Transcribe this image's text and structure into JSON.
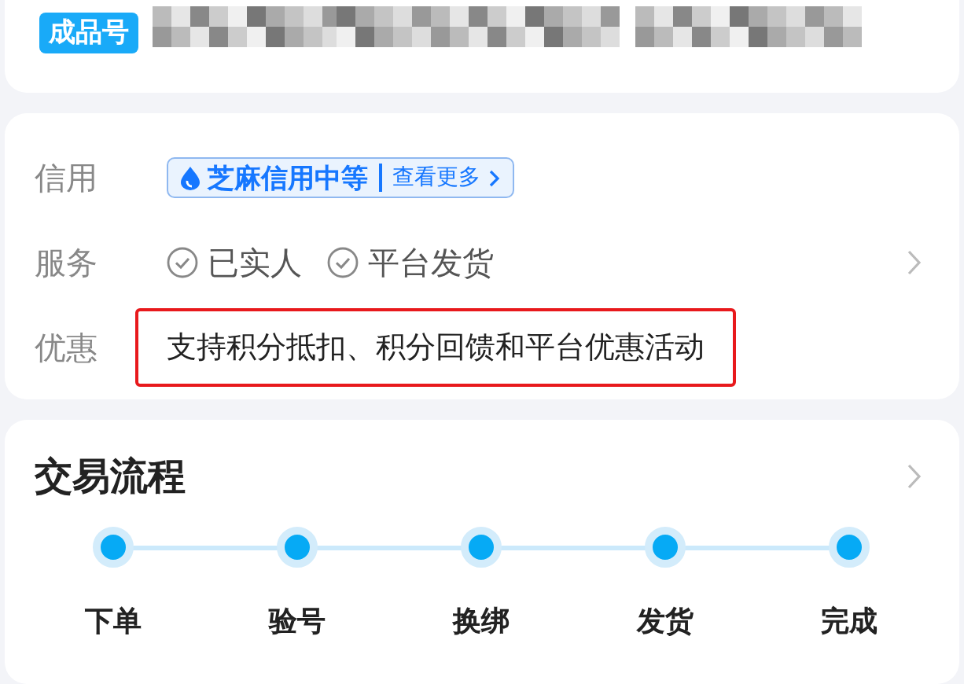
{
  "product": {
    "badge": "成品号"
  },
  "info": {
    "rows": [
      {
        "kind": "credit",
        "label": "信用",
        "value": "芝麻信用中等",
        "link": "查看更多"
      },
      {
        "kind": "services",
        "label": "服务",
        "items": [
          "已实人",
          "平台发货"
        ]
      },
      {
        "kind": "promo",
        "label": "优惠",
        "text": "支持积分抵扣、积分回馈和平台优惠活动",
        "highlighted": true
      }
    ]
  },
  "process": {
    "title": "交易流程",
    "steps": [
      {
        "label": "下单"
      },
      {
        "label": "验号"
      },
      {
        "label": "换绑"
      },
      {
        "label": "发货"
      },
      {
        "label": "完成"
      }
    ]
  }
}
